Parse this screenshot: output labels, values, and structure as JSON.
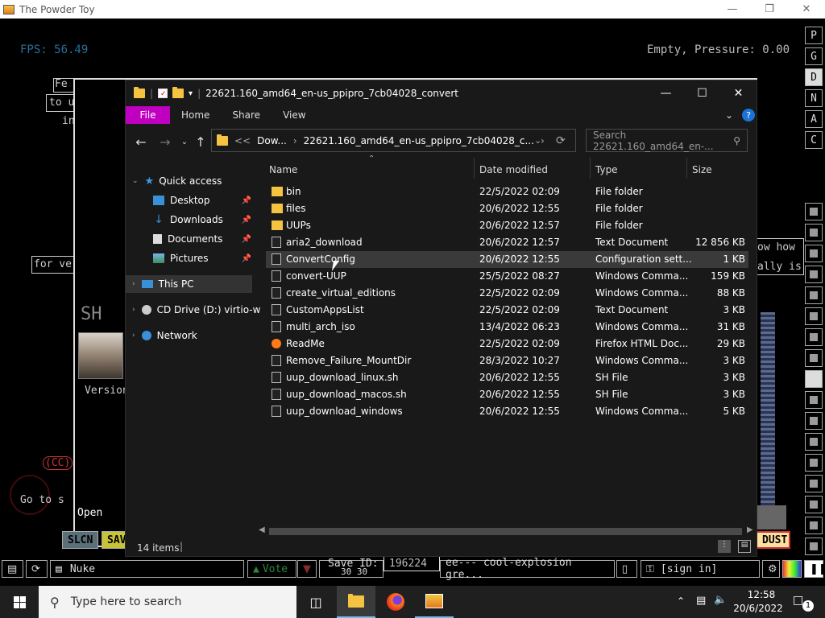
{
  "powder_toy": {
    "window_title": "The Powder Toy",
    "fps": "FPS: 56.49",
    "pressure": "Empty, Pressure: 0.00",
    "right_buttons": [
      "P",
      "G",
      "D",
      "N",
      "A",
      "C"
    ],
    "bottom": {
      "slcn": "SLCN",
      "sav": "SAV",
      "dust": "DUST",
      "search_value": "Nuke",
      "vote": "Vote",
      "save_id_label": "Save ID:",
      "save_id": "196224",
      "save_info": "ee--- cool-explosion gre...",
      "sign_in": "[sign in]",
      "open_label": "Open",
      "cc": "(CC)",
      "goto": "Go to s",
      "version": "Version",
      "fer": "Fe",
      "to_u": "to u",
      "in": "in",
      "for_ve": "for ve",
      "ow_how": "ow how",
      "ally_is": "ally is",
      "num_3030": "30 30"
    }
  },
  "explorer": {
    "title": "22621.160_amd64_en-us_ppipro_7cb04028_convert",
    "ribbon_tabs": [
      "File",
      "Home",
      "Share",
      "View"
    ],
    "address_parts": [
      "<<",
      "Dow...",
      "22621.160_amd64_en-us_ppipro_7cb04028_c..."
    ],
    "search_placeholder": "Search 22621.160_amd64_en-...",
    "nav": {
      "quick_access": "Quick access",
      "desktop": "Desktop",
      "downloads": "Downloads",
      "documents": "Documents",
      "pictures": "Pictures",
      "this_pc": "This PC",
      "cd_drive": "CD Drive (D:) virtio-w",
      "network": "Network"
    },
    "columns": {
      "name": "Name",
      "date": "Date modified",
      "type": "Type",
      "size": "Size"
    },
    "files": [
      {
        "name": "bin",
        "date": "22/5/2022 02:09",
        "type": "File folder",
        "size": "",
        "kind": "folder"
      },
      {
        "name": "files",
        "date": "20/6/2022 12:55",
        "type": "File folder",
        "size": "",
        "kind": "folder"
      },
      {
        "name": "UUPs",
        "date": "20/6/2022 12:57",
        "type": "File folder",
        "size": "",
        "kind": "folder"
      },
      {
        "name": "aria2_download",
        "date": "20/6/2022 12:57",
        "type": "Text Document",
        "size": "12 856 KB",
        "kind": "text"
      },
      {
        "name": "ConvertConfig",
        "date": "20/6/2022 12:55",
        "type": "Configuration sett...",
        "size": "1 KB",
        "kind": "config"
      },
      {
        "name": "convert-UUP",
        "date": "25/5/2022 08:27",
        "type": "Windows Comma...",
        "size": "159 KB",
        "kind": "cmd"
      },
      {
        "name": "create_virtual_editions",
        "date": "22/5/2022 02:09",
        "type": "Windows Comma...",
        "size": "88 KB",
        "kind": "cmd"
      },
      {
        "name": "CustomAppsList",
        "date": "22/5/2022 02:09",
        "type": "Text Document",
        "size": "3 KB",
        "kind": "text"
      },
      {
        "name": "multi_arch_iso",
        "date": "13/4/2022 06:23",
        "type": "Windows Comma...",
        "size": "31 KB",
        "kind": "cmd"
      },
      {
        "name": "ReadMe",
        "date": "22/5/2022 02:09",
        "type": "Firefox HTML Doc...",
        "size": "29 KB",
        "kind": "html"
      },
      {
        "name": "Remove_Failure_MountDir",
        "date": "28/3/2022 10:27",
        "type": "Windows Comma...",
        "size": "3 KB",
        "kind": "cmd"
      },
      {
        "name": "uup_download_linux.sh",
        "date": "20/6/2022 12:55",
        "type": "SH File",
        "size": "3 KB",
        "kind": "file"
      },
      {
        "name": "uup_download_macos.sh",
        "date": "20/6/2022 12:55",
        "type": "SH File",
        "size": "3 KB",
        "kind": "file"
      },
      {
        "name": "uup_download_windows",
        "date": "20/6/2022 12:55",
        "type": "Windows Comma...",
        "size": "5 KB",
        "kind": "cmd"
      }
    ],
    "status_items": "14 items",
    "accent": "#c000c0"
  },
  "taskbar": {
    "search_placeholder": "Type here to search",
    "time": "12:58",
    "date": "20/6/2022",
    "notif_count": "1"
  }
}
